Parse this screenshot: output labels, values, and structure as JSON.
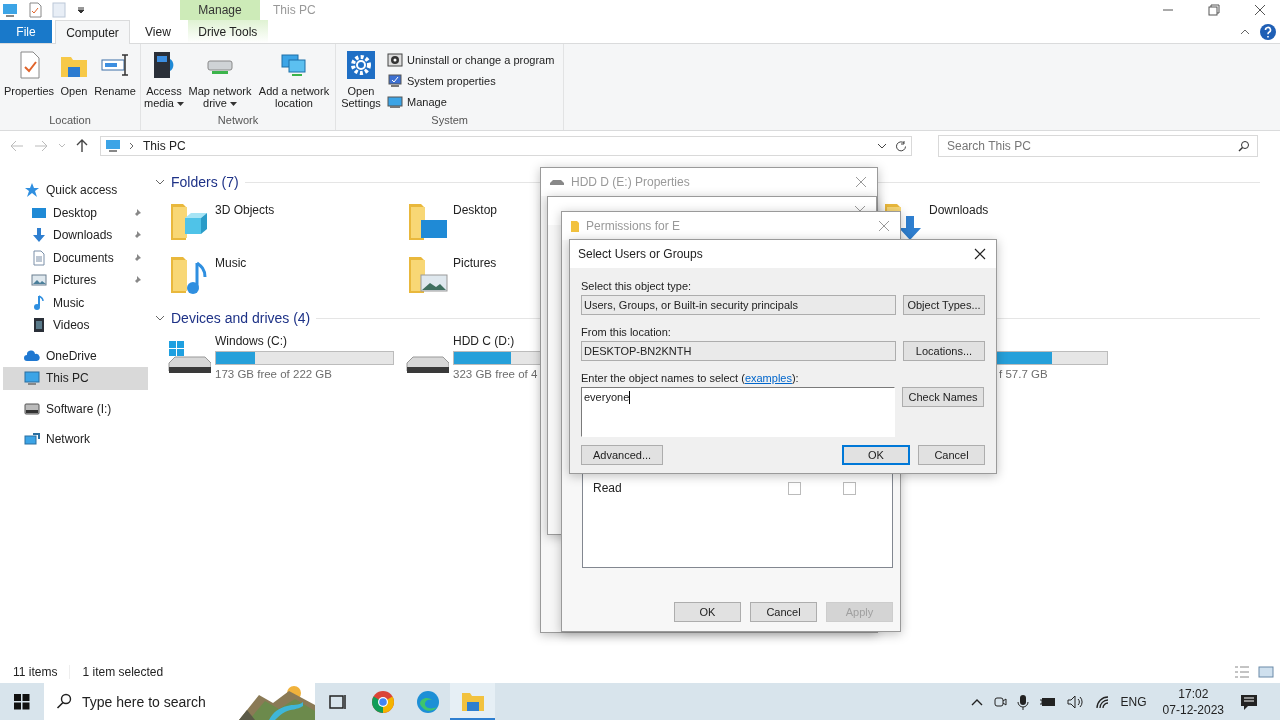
{
  "window": {
    "title": "This PC",
    "context_tab": "Manage"
  },
  "ribbon_tabs": [
    {
      "label": "File",
      "kind": "file",
      "selected": false
    },
    {
      "label": "Computer",
      "kind": "tab",
      "selected": true
    },
    {
      "label": "View",
      "kind": "tab",
      "selected": false
    },
    {
      "label": "Drive Tools",
      "kind": "context",
      "selected": false
    }
  ],
  "ribbon_groups": [
    {
      "label": "Location",
      "large_buttons": [
        {
          "label": "Properties",
          "dropdown": false
        },
        {
          "label": "Open",
          "dropdown": false
        },
        {
          "label": "Rename",
          "dropdown": false
        }
      ]
    },
    {
      "label": "Network",
      "large_buttons": [
        {
          "label": "Access media",
          "dropdown": true
        },
        {
          "label": "Map network drive",
          "dropdown": true
        },
        {
          "label": "Add a network location",
          "dropdown": false
        }
      ]
    },
    {
      "label": "System",
      "large_buttons": [
        {
          "label": "Open Settings",
          "dropdown": false
        }
      ],
      "small_buttons": [
        "Uninstall or change a program",
        "System properties",
        "Manage"
      ]
    }
  ],
  "address": {
    "path": "This PC",
    "search_placeholder": "Search This PC"
  },
  "nav": [
    {
      "label": "Quick access",
      "selected": false,
      "children": [
        {
          "label": "Desktop",
          "pinned": true,
          "selected": false
        },
        {
          "label": "Downloads",
          "pinned": true,
          "selected": false
        },
        {
          "label": "Documents",
          "pinned": true,
          "selected": false
        },
        {
          "label": "Pictures",
          "pinned": true,
          "selected": false
        },
        {
          "label": "Music",
          "pinned": false,
          "selected": false
        },
        {
          "label": "Videos",
          "pinned": false,
          "selected": false
        }
      ]
    },
    {
      "label": "OneDrive",
      "selected": false
    },
    {
      "label": "This PC",
      "selected": true
    },
    {
      "label": "Software (I:)",
      "selected": false
    },
    {
      "label": "Network",
      "selected": false
    }
  ],
  "folders": {
    "heading": "Folders (7)",
    "items": [
      {
        "name": "3D Objects"
      },
      {
        "name": "Desktop"
      },
      {
        "name": "Downloads"
      },
      {
        "name": "Music"
      },
      {
        "name": "Pictures"
      }
    ]
  },
  "drives": {
    "heading": "Devices and drives (4)",
    "items": [
      {
        "name": "Windows (C:)",
        "level": 0.22,
        "free": "173 GB free of 222 GB"
      },
      {
        "name": "HDD C (D:)",
        "level": 0.32,
        "free": "323 GB free of 4"
      },
      {
        "level": 0.69,
        "free": "f 57.7 GB"
      }
    ]
  },
  "dialogs": [
    {
      "kind": "properties",
      "title": "HDD D (E:) Properties"
    },
    {
      "kind": "advanced_sharing"
    },
    {
      "kind": "permissions",
      "title": "Permissions for E",
      "rows": [
        {
          "label": "Read",
          "allow": false,
          "deny": false
        }
      ],
      "buttons": [
        {
          "label": "OK",
          "disabled": false
        },
        {
          "label": "Cancel",
          "disabled": false
        },
        {
          "label": "Apply",
          "disabled": true
        }
      ]
    },
    {
      "kind": "select_users",
      "title": "Select Users or Groups",
      "object_type_label": "Select this object type:",
      "object_type": "Users, Groups, or Built-in security principals",
      "object_type_button": "Object Types...",
      "location_label": "From this location:",
      "location": "DESKTOP-BN2KNTH",
      "location_button": "Locations...",
      "names_label": "Enter the object names to select (",
      "names_link": "examples",
      "names_suffix": "):",
      "names": "everyone",
      "check_button": "Check Names",
      "advanced_button": "Advanced...",
      "ok_button": "OK",
      "cancel_button": "Cancel"
    }
  ],
  "status_bar": {
    "item_count": "11 items",
    "selection": "1 item selected"
  },
  "taskbar": {
    "search_placeholder": "Type here to search",
    "apps": [
      {
        "active": false
      },
      {
        "active": false
      },
      {
        "active": false
      },
      {
        "active": true
      }
    ],
    "language": "ENG",
    "time": "17:02",
    "date": "07-12-2023"
  }
}
